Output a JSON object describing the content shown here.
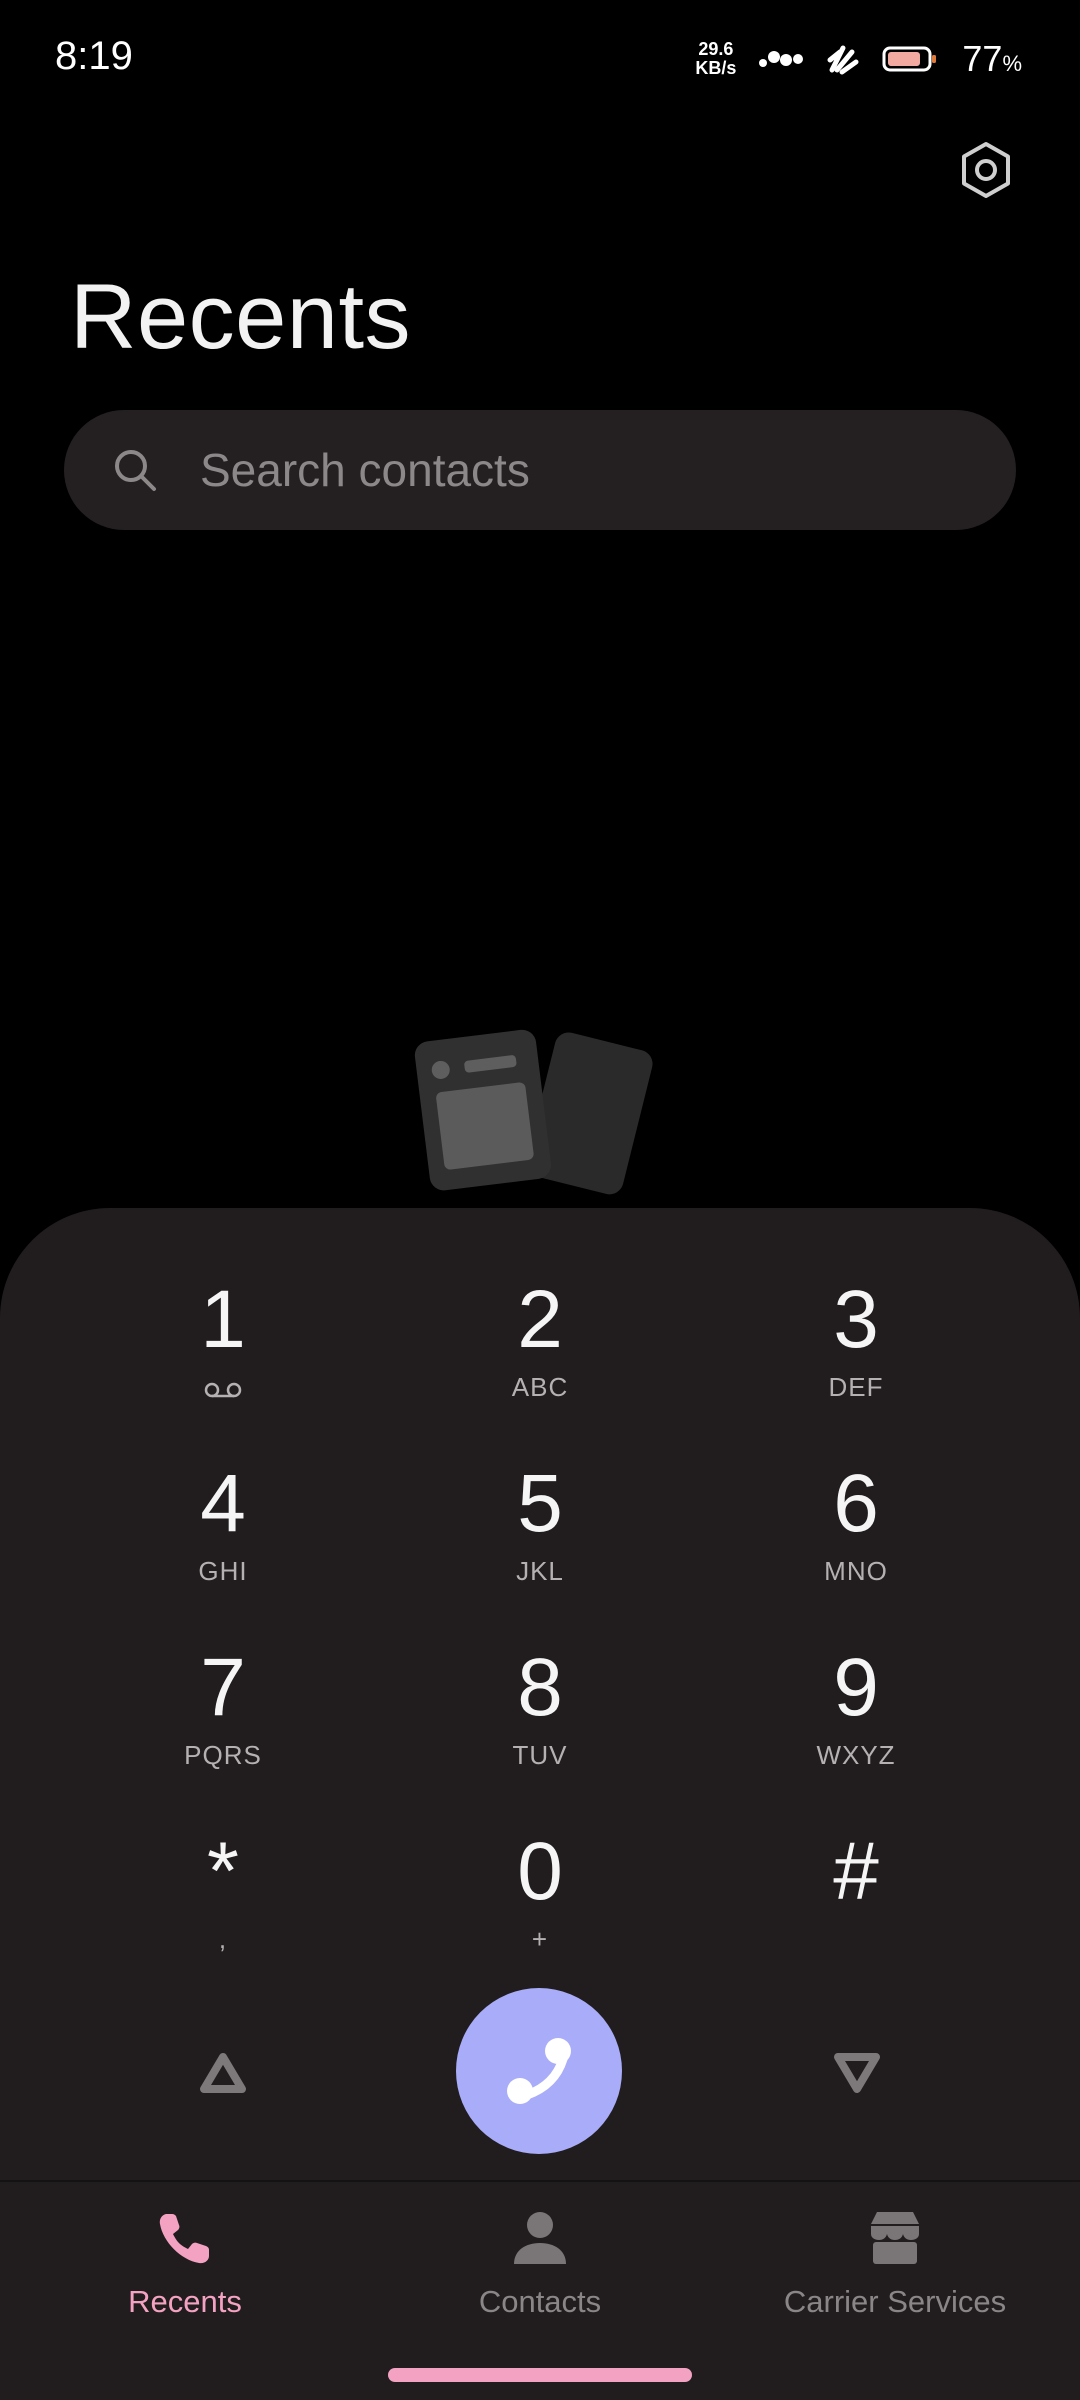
{
  "status_bar": {
    "time": "8:19",
    "net_speed_value": "29.6",
    "net_speed_unit": "KB/s",
    "battery_percent": "77",
    "battery_percent_sign": "%"
  },
  "header": {
    "title": "Recents",
    "settings_icon": "settings-hexagon-icon"
  },
  "search": {
    "placeholder": "Search contacts"
  },
  "dialpad": {
    "keys": [
      {
        "digit": "1",
        "letters": ""
      },
      {
        "digit": "2",
        "letters": "ABC"
      },
      {
        "digit": "3",
        "letters": "DEF"
      },
      {
        "digit": "4",
        "letters": "GHI"
      },
      {
        "digit": "5",
        "letters": "JKL"
      },
      {
        "digit": "6",
        "letters": "MNO"
      },
      {
        "digit": "7",
        "letters": "PQRS"
      },
      {
        "digit": "8",
        "letters": "TUV"
      },
      {
        "digit": "9",
        "letters": "WXYZ"
      },
      {
        "digit": "*",
        "letters": ","
      },
      {
        "digit": "0",
        "letters": "+"
      },
      {
        "digit": "#",
        "letters": ""
      }
    ],
    "call_button_color": "#a9acf8"
  },
  "bottom_nav": {
    "items": [
      {
        "label": "Recents",
        "icon": "phone-icon",
        "active": true
      },
      {
        "label": "Contacts",
        "icon": "person-icon",
        "active": false
      },
      {
        "label": "Carrier Services",
        "icon": "store-icon",
        "active": false
      }
    ],
    "active_color": "#f4a2c2"
  }
}
